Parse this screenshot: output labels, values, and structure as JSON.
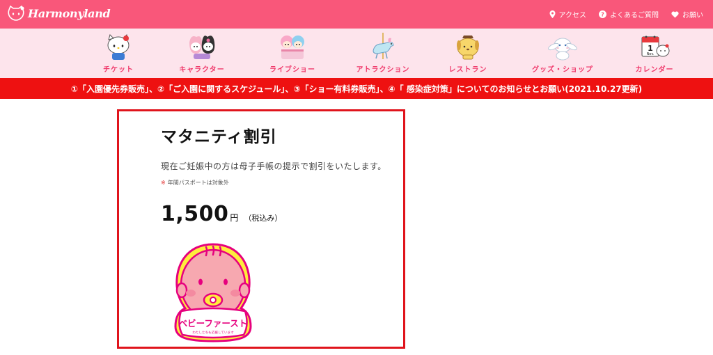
{
  "header": {
    "logo_text": "Harmonyland",
    "links": [
      {
        "label": "アクセス",
        "icon": "pin-icon"
      },
      {
        "label": "よくあるご質問",
        "icon": "question-icon"
      },
      {
        "label": "お願い",
        "icon": "heart-icon"
      }
    ]
  },
  "nav": {
    "items": [
      {
        "label": "チケット",
        "icon": "hello-kitty-icon"
      },
      {
        "label": "キャラクター",
        "icon": "kuromi-melody-icon"
      },
      {
        "label": "ライブショー",
        "icon": "little-twin-stars-icon"
      },
      {
        "label": "アトラクション",
        "icon": "carousel-horse-icon"
      },
      {
        "label": "レストラン",
        "icon": "pompompurin-icon"
      },
      {
        "label": "グッズ・ショップ",
        "icon": "cinnamoroll-icon"
      },
      {
        "label": "カレンダー",
        "icon": "calendar-kitty-icon"
      }
    ]
  },
  "calendar_icon": {
    "day": "1",
    "month": "Nov."
  },
  "notice": "①「入園優先券販売」、②「ご入園に関するスケジュール」、③「ショー有料券販売」、④「 感染症対策」についてのお知らせとお願い(2021.10.27更新)",
  "card": {
    "title": "マタニティ割引",
    "description": "現在ご妊娠中の方は母子手帳の提示で割引をいたします。",
    "note_mark": "※",
    "note": "年間パスポートは対象外",
    "price": "1,500",
    "price_unit": "円",
    "tax": "（税込み）",
    "badge": {
      "main_text": "ベビーファースト",
      "sub_text": "わたしたちも応援しています"
    }
  },
  "colors": {
    "brand_pink": "#f9577a",
    "nav_bg": "#fde4ec",
    "notice_red": "#ee1111",
    "card_border": "#e0141c"
  }
}
